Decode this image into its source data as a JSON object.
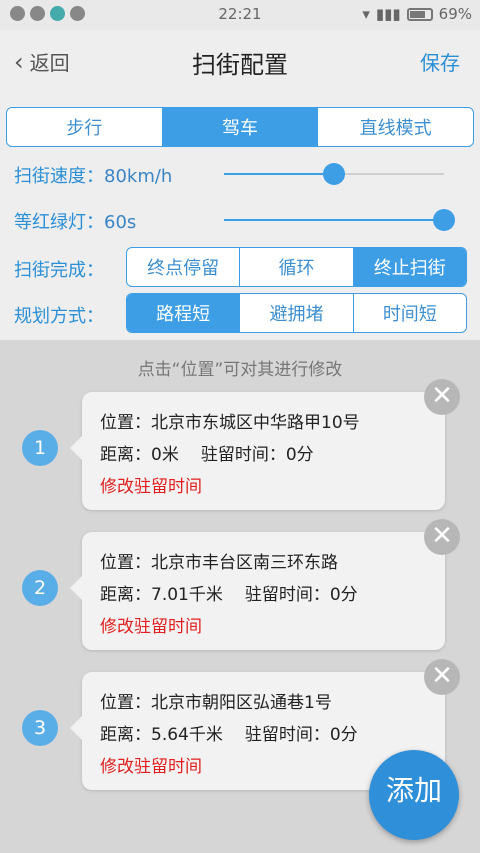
{
  "status_bar": {
    "time": "22:21",
    "battery": "69%"
  },
  "nav": {
    "back_label": "返回",
    "title": "扫街配置",
    "save_label": "保存"
  },
  "mode_tabs": [
    {
      "label": "步行",
      "active": false
    },
    {
      "label": "驾车",
      "active": true
    },
    {
      "label": "直线模式",
      "active": false
    }
  ],
  "speed": {
    "label": "扫街速度：",
    "value": "80km/h",
    "level": 0.5
  },
  "traffic_light": {
    "label": "等红绿灯：",
    "value": "60s",
    "level": 1.0
  },
  "finish": {
    "label": "扫街完成：",
    "options": [
      {
        "label": "终点停留",
        "active": false
      },
      {
        "label": "循环",
        "active": false
      },
      {
        "label": "终止扫街",
        "active": true
      }
    ]
  },
  "plan": {
    "label": "规划方式：",
    "options": [
      {
        "label": "路程短",
        "active": true
      },
      {
        "label": "避拥堵",
        "active": false
      },
      {
        "label": "时间短",
        "active": false
      }
    ]
  },
  "hint": "点击“位置”可对其进行修改",
  "waypoints": [
    {
      "index": "1",
      "location": "位置：北京市东城区中华路甲10号",
      "distance": "距离：0米",
      "stay": "驻留时间：0分",
      "edit_label": "修改驻留时间"
    },
    {
      "index": "2",
      "location": "位置：北京市丰台区南三环东路",
      "distance": "距离：7.01千米",
      "stay": "驻留时间：0分",
      "edit_label": "修改驻留时间"
    },
    {
      "index": "3",
      "location": "位置：北京市朝阳区弘通巷1号",
      "distance": "距离：5.64千米",
      "stay": "驻留时间：0分",
      "edit_label": "修改驻留时间"
    }
  ],
  "fab_label": "添加",
  "colors": {
    "accent": "#3d9ee6",
    "edit_text": "#e02020"
  }
}
